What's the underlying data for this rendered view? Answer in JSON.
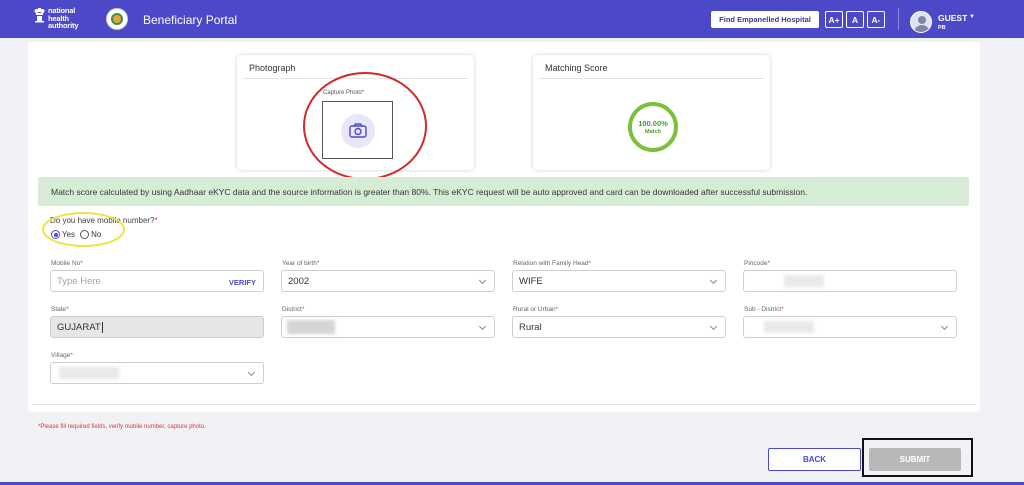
{
  "header": {
    "nha_logo_text": [
      "national",
      "health",
      "authority"
    ],
    "portal_title": "Beneficiary Portal",
    "find_hospital_label": "Find Empanelled Hospital",
    "font_increase": "A+",
    "font_normal": "A",
    "font_decrease": "A-",
    "user_name": "GUEST",
    "user_state": "PB"
  },
  "photo_panel": {
    "title": "Photograph",
    "capture_label": "Capture Photo*"
  },
  "score_panel": {
    "title": "Matching Score",
    "score": "100.00%",
    "score_sub": "Match"
  },
  "alert_text": "Match score calculated by using Aadhaar eKYC data and the source information is greater than 80%. This eKYC request will be auto approved and card can be downloaded after successful submission.",
  "mobile_question": {
    "label": "Do you have mobile number?",
    "yes": "Yes",
    "no": "No",
    "selected": "Yes"
  },
  "fields": {
    "mobile": {
      "label": "Mobile No",
      "placeholder": "Type Here",
      "action": "VERIFY"
    },
    "year_of_birth": {
      "label": "Year of birth",
      "value": "2002"
    },
    "relation": {
      "label": "Relation with Family Head",
      "value": "WIFE"
    },
    "pincode": {
      "label": "Pincode",
      "value": ""
    },
    "state": {
      "label": "State",
      "value": "GUJARAT"
    },
    "district": {
      "label": "District",
      "value": ""
    },
    "rural_urban": {
      "label": "Rural or Urban",
      "value": "Rural"
    },
    "sub_district": {
      "label": "Sub - District",
      "value": ""
    },
    "village": {
      "label": "Village",
      "value": ""
    }
  },
  "required_mark": "*",
  "footer_note": "*Please fill required fields, verify mobile number, capture photo.",
  "buttons": {
    "back": "BACK",
    "submit": "SUBMIT"
  },
  "colors": {
    "brand": "#4c49c9",
    "alert_bg": "#d6ecd4",
    "score_ring": "#7bbf3a",
    "annotation_red": "#d12a2a",
    "annotation_yellow": "#efe23a"
  }
}
